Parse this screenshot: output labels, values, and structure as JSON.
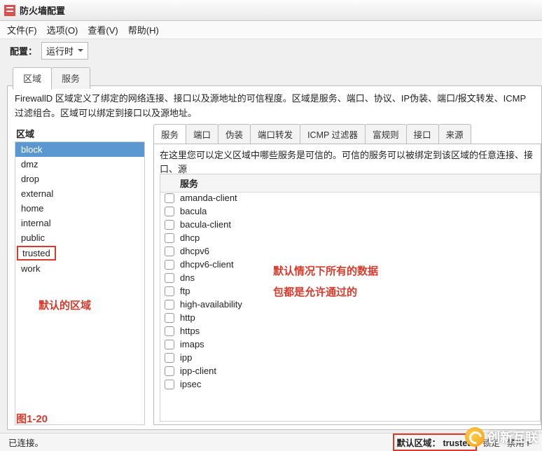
{
  "title": "防火墙配置",
  "menubar": [
    "文件(F)",
    "选项(O)",
    "查看(V)",
    "帮助(H)"
  ],
  "toolbar": {
    "config_label": "配置：",
    "config_value": "运行时"
  },
  "outer_tabs": [
    "区域",
    "服务"
  ],
  "zone_description": "FirewallD 区域定义了绑定的网络连接、接口以及源地址的可信程度。区域是服务、端口、协议、IP伪装、端口/报文转发、ICMP过滤组合。区域可以绑定到接口以及源地址。",
  "zone_heading": "区域",
  "zones": [
    "block",
    "dmz",
    "drop",
    "external",
    "home",
    "internal",
    "public",
    "trusted",
    "work"
  ],
  "zone_selected_index": 0,
  "zone_boxed_index": 7,
  "inner_tabs": [
    "服务",
    "端口",
    "伪装",
    "端口转发",
    "ICMP 过滤器",
    "富规则",
    "接口",
    "来源"
  ],
  "svc_description": "在这里您可以定义区域中哪些服务是可信的。可信的服务可以被绑定到该区域的任意连接、接口、源",
  "svc_col_header": "服务",
  "services": [
    "amanda-client",
    "bacula",
    "bacula-client",
    "dhcp",
    "dhcpv6",
    "dhcpv6-client",
    "dns",
    "ftp",
    "high-availability",
    "http",
    "https",
    "imaps",
    "ipp",
    "ipp-client",
    "ipsec"
  ],
  "annotations": {
    "default_zone": "默认的区域",
    "fig_label": "图1-20",
    "services_note_1": "默认情况下所有的数据",
    "services_note_2": "包都是允许通过的"
  },
  "statusbar": {
    "connected": "已连接。",
    "default_zone_label": "默认区域：",
    "default_zone_value": "trusted",
    "btn_lock": "锁定",
    "btn_disable": "禁用 F"
  },
  "watermark": "创新互联"
}
